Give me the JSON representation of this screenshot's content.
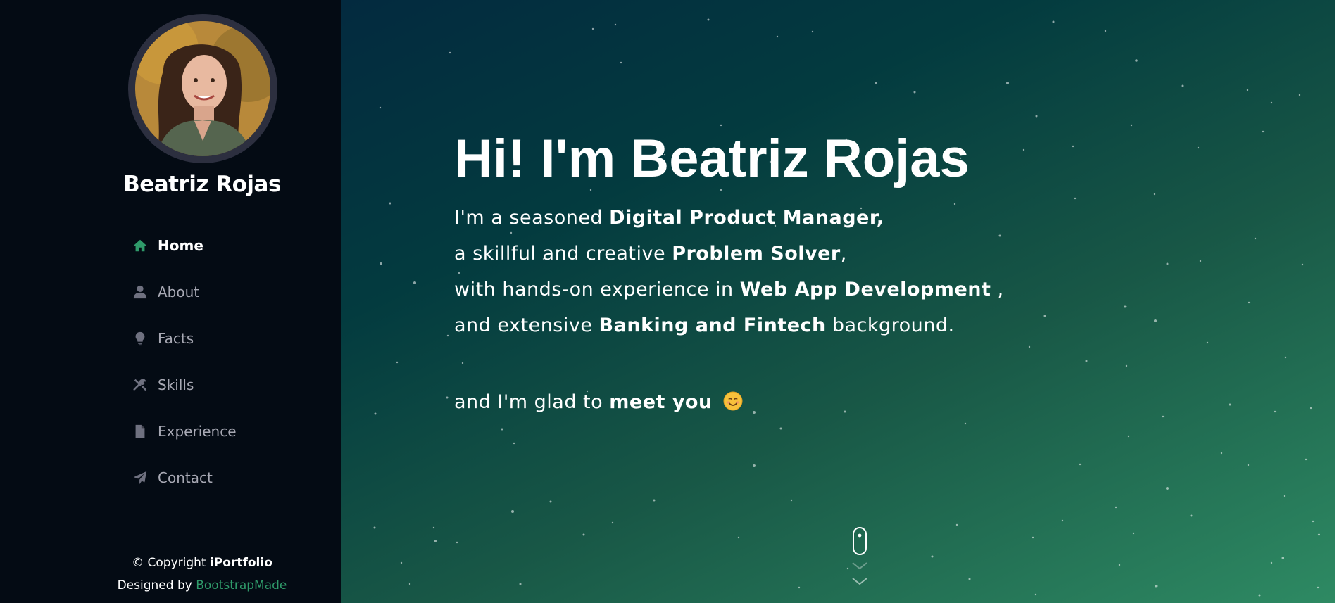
{
  "sidebar": {
    "profile": {
      "name": "Beatriz Rojas"
    },
    "nav": [
      {
        "label": "Home",
        "icon": "home-icon",
        "active": true
      },
      {
        "label": "About",
        "icon": "user-icon",
        "active": false
      },
      {
        "label": "Facts",
        "icon": "lightbulb-icon",
        "active": false
      },
      {
        "label": "Skills",
        "icon": "tools-icon",
        "active": false
      },
      {
        "label": "Experience",
        "icon": "document-icon",
        "active": false
      },
      {
        "label": "Contact",
        "icon": "send-icon",
        "active": false
      }
    ],
    "footer": {
      "copyright_prefix": "© Copyright ",
      "brand": "iPortfolio",
      "designed_by": "Designed by ",
      "designer_link": "BootstrapMade"
    }
  },
  "hero": {
    "title": "Hi! I'm Beatriz Rojas",
    "line1": {
      "text": "I'm a seasoned ",
      "bold": "Digital Product Manager,"
    },
    "line2": {
      "text": "a skillful and creative ",
      "bold": "Problem Solver",
      "after": ","
    },
    "line3": {
      "text": "with hands-on experience in ",
      "bold": "Web App Development",
      "after": " ,"
    },
    "line4": {
      "text": "and extensive ",
      "bold": "Banking and Fintech",
      "after": " background."
    },
    "greeting": {
      "text": "and I'm glad to ",
      "bold": "meet you",
      "emoji": "😊"
    }
  },
  "colors": {
    "sidebar_bg": "#040b14",
    "accent": "#2f9a6a",
    "nav_text": "#a8a9b4",
    "avatar_border": "#2c2f3f"
  }
}
